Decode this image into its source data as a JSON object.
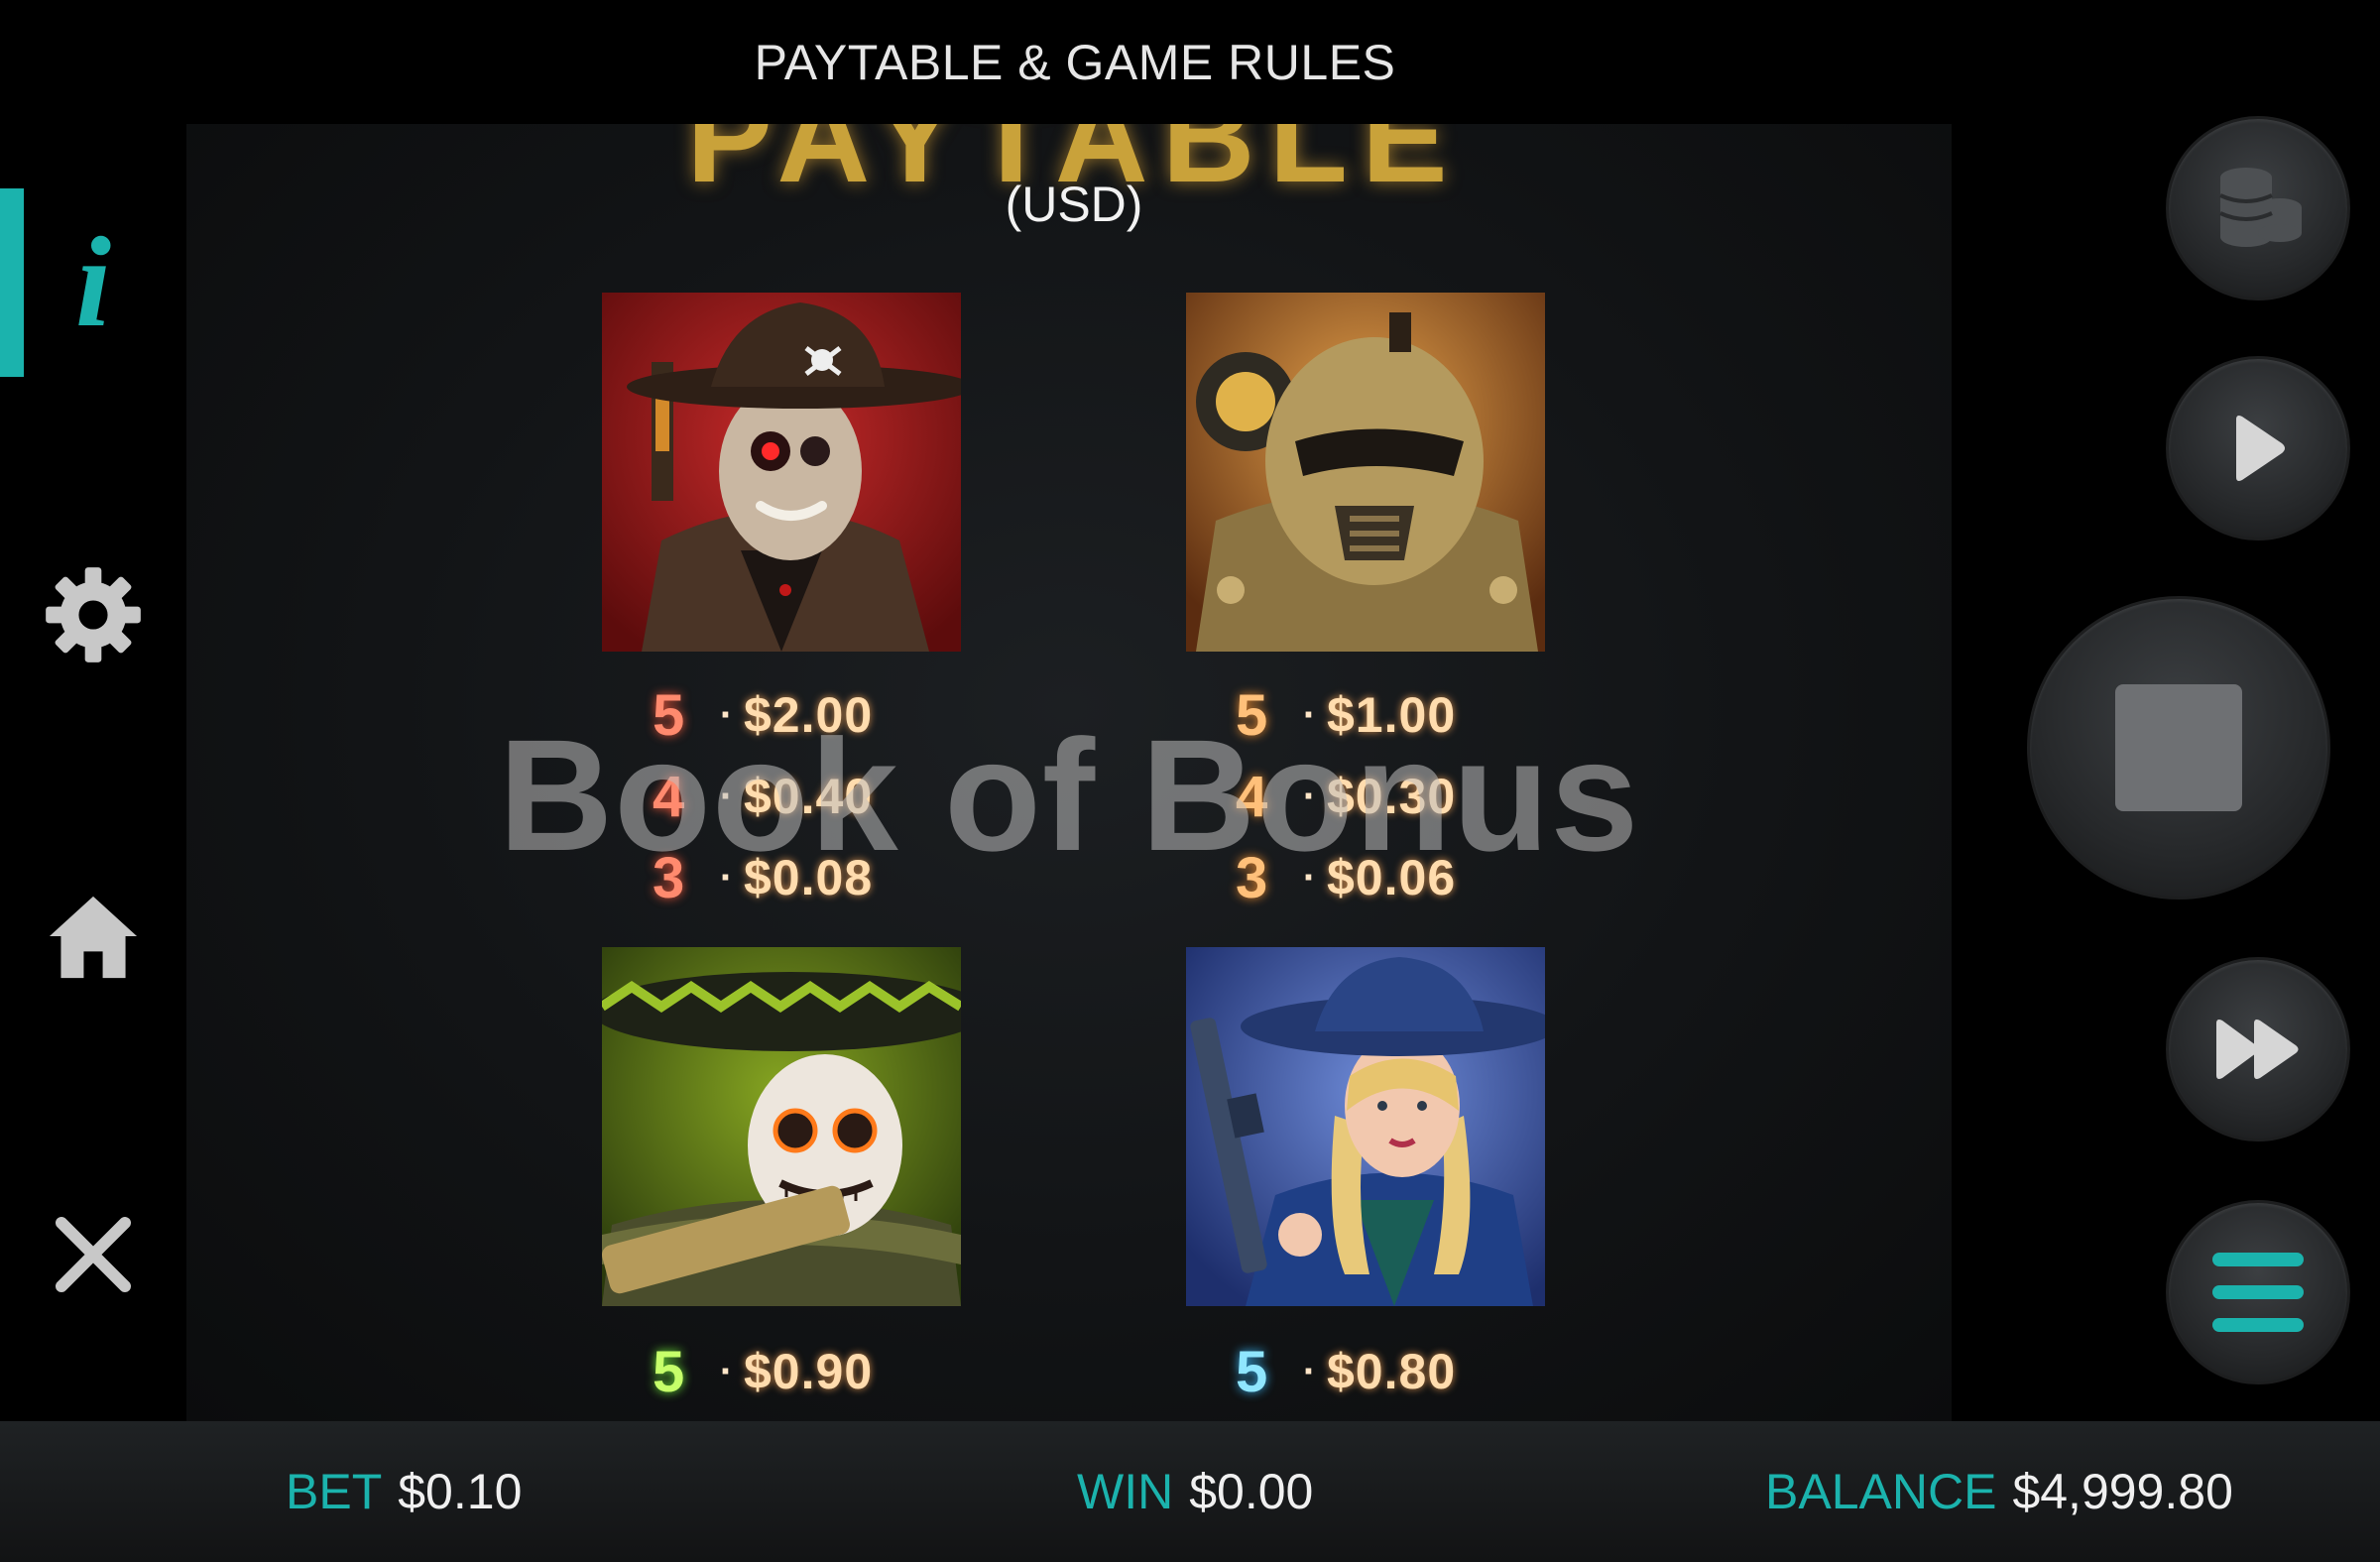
{
  "header": {
    "title": "PAYTABLE & GAME RULES"
  },
  "nav": {
    "items": [
      {
        "icon": "info-icon",
        "active": true
      },
      {
        "icon": "gear-icon",
        "active": false
      },
      {
        "icon": "home-icon",
        "active": false
      },
      {
        "icon": "close-icon",
        "active": false
      }
    ]
  },
  "paytable": {
    "heading": "PAYTABLE",
    "currency": "(USD)",
    "symbols": [
      {
        "name": "skull-gunslinger-symbol",
        "pays": [
          {
            "count": "5",
            "amount": "$2.00"
          },
          {
            "count": "4",
            "amount": "$0.40"
          },
          {
            "count": "3",
            "amount": "$0.08"
          }
        ]
      },
      {
        "name": "armored-soldier-symbol",
        "pays": [
          {
            "count": "5",
            "amount": "$1.00"
          },
          {
            "count": "4",
            "amount": "$0.30"
          },
          {
            "count": "3",
            "amount": "$0.06"
          }
        ]
      },
      {
        "name": "sugar-skull-sombrero-symbol",
        "pays": [
          {
            "count": "5",
            "amount": "$0.90"
          }
        ]
      },
      {
        "name": "blonde-gunwoman-symbol",
        "pays": [
          {
            "count": "5",
            "amount": "$0.80"
          }
        ]
      }
    ]
  },
  "watermark": "Book of Bonus",
  "controls": [
    {
      "icon": "coins-icon"
    },
    {
      "icon": "play-icon"
    },
    {
      "icon": "stop-icon"
    },
    {
      "icon": "fast-forward-icon"
    },
    {
      "icon": "menu-icon"
    }
  ],
  "status": {
    "bet_label": "BET",
    "bet_value": "$0.10",
    "win_label": "WIN",
    "win_value": "$0.00",
    "balance_label": "BALANCE",
    "balance_value": "$4,999.80"
  },
  "colors": {
    "accent": "#1bb3ad",
    "gold": "#c9a23a"
  }
}
